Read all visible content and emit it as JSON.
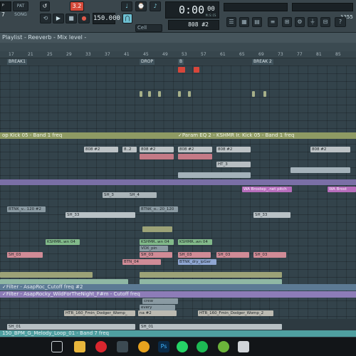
{
  "toolbar": {
    "pattern_num": "ᴾ 7",
    "pat_song": "PAT  SONG",
    "bpm": "150.000",
    "time": "0:00",
    "time_ms": "00",
    "time_sub": "M:S:CS",
    "snap": "Cell",
    "pattern_name": "808 #2",
    "pct": "1255"
  },
  "playlist": {
    "title": "Playlist - Reeverb - Mix level -"
  },
  "ruler": {
    "ticks": [
      "17",
      "21",
      "25",
      "29",
      "33",
      "37",
      "41",
      "45",
      "49",
      "53",
      "57",
      "61",
      "65",
      "69",
      "73",
      "77",
      "81",
      "85"
    ]
  },
  "markers": {
    "break1": "BREAK1",
    "drop": "DROP",
    "b": "B",
    "break2": "BREAK 2"
  },
  "tracks": {
    "kick_auto": "op Kick 05 - Band 1 freq",
    "param_eq": "✓Param EQ 2 - KSHMR Ir. Kick 05 - Band 1 freq",
    "c808": "808 #2",
    "c808b": "808 #2",
    "c808c": "8..2",
    "ht3": "HT_3",
    "wa_brostep": "WA Brostep_.net pitch",
    "wa_brost2": "WA Brost",
    "sh3": "SH_3",
    "sh4": "SH_4",
    "btnk_v": "BTNK_v.. 120 #2",
    "btnk_2": "BTNK_o.. 20_120",
    "sh33": "SH_33",
    "kshmr1": "KSHMR..wn 04",
    "kshmr2": "KSHMR..wn 04",
    "kshmr3": "KSHMR..wn 04",
    "vox": "VOX_pin",
    "sh03": "SH_03",
    "btn04": "BTN_04",
    "btnk_dry": "BTNK_dry_ipGer",
    "filter1": "✓Filter - AsapRoc_Cutoff freq #2",
    "filter2": "✓Filter - AsapRocky_WildForTheNight_F#m - Cutoff freq",
    "crew": "crew",
    "every": "every",
    "htr1": "HTR_160_Fmin_Dodger_Womp_",
    "htr2": "HTR_160_Fmin_Dodger_Womp_2",
    "na2": "na #2",
    "sh01": "SH_01",
    "melody": "150_BPM_G_Melody_Loop_01 - Band 7 freq"
  },
  "taskbar": {
    "icons": [
      "task-view-icon",
      "file-explorer-icon",
      "opera-icon",
      "fl-studio-icon",
      "photoshop-icon",
      "whatsapp-icon",
      "spotify-icon",
      "utorrent-icon",
      "chrome-icon"
    ]
  },
  "colors": {
    "accent_red": "#e0463a",
    "time_lcd": "#1a2125",
    "olive": "#9aa27a",
    "pink": "#c4707c",
    "teal": "#4f9fa0",
    "purple": "#8d7cb8"
  }
}
